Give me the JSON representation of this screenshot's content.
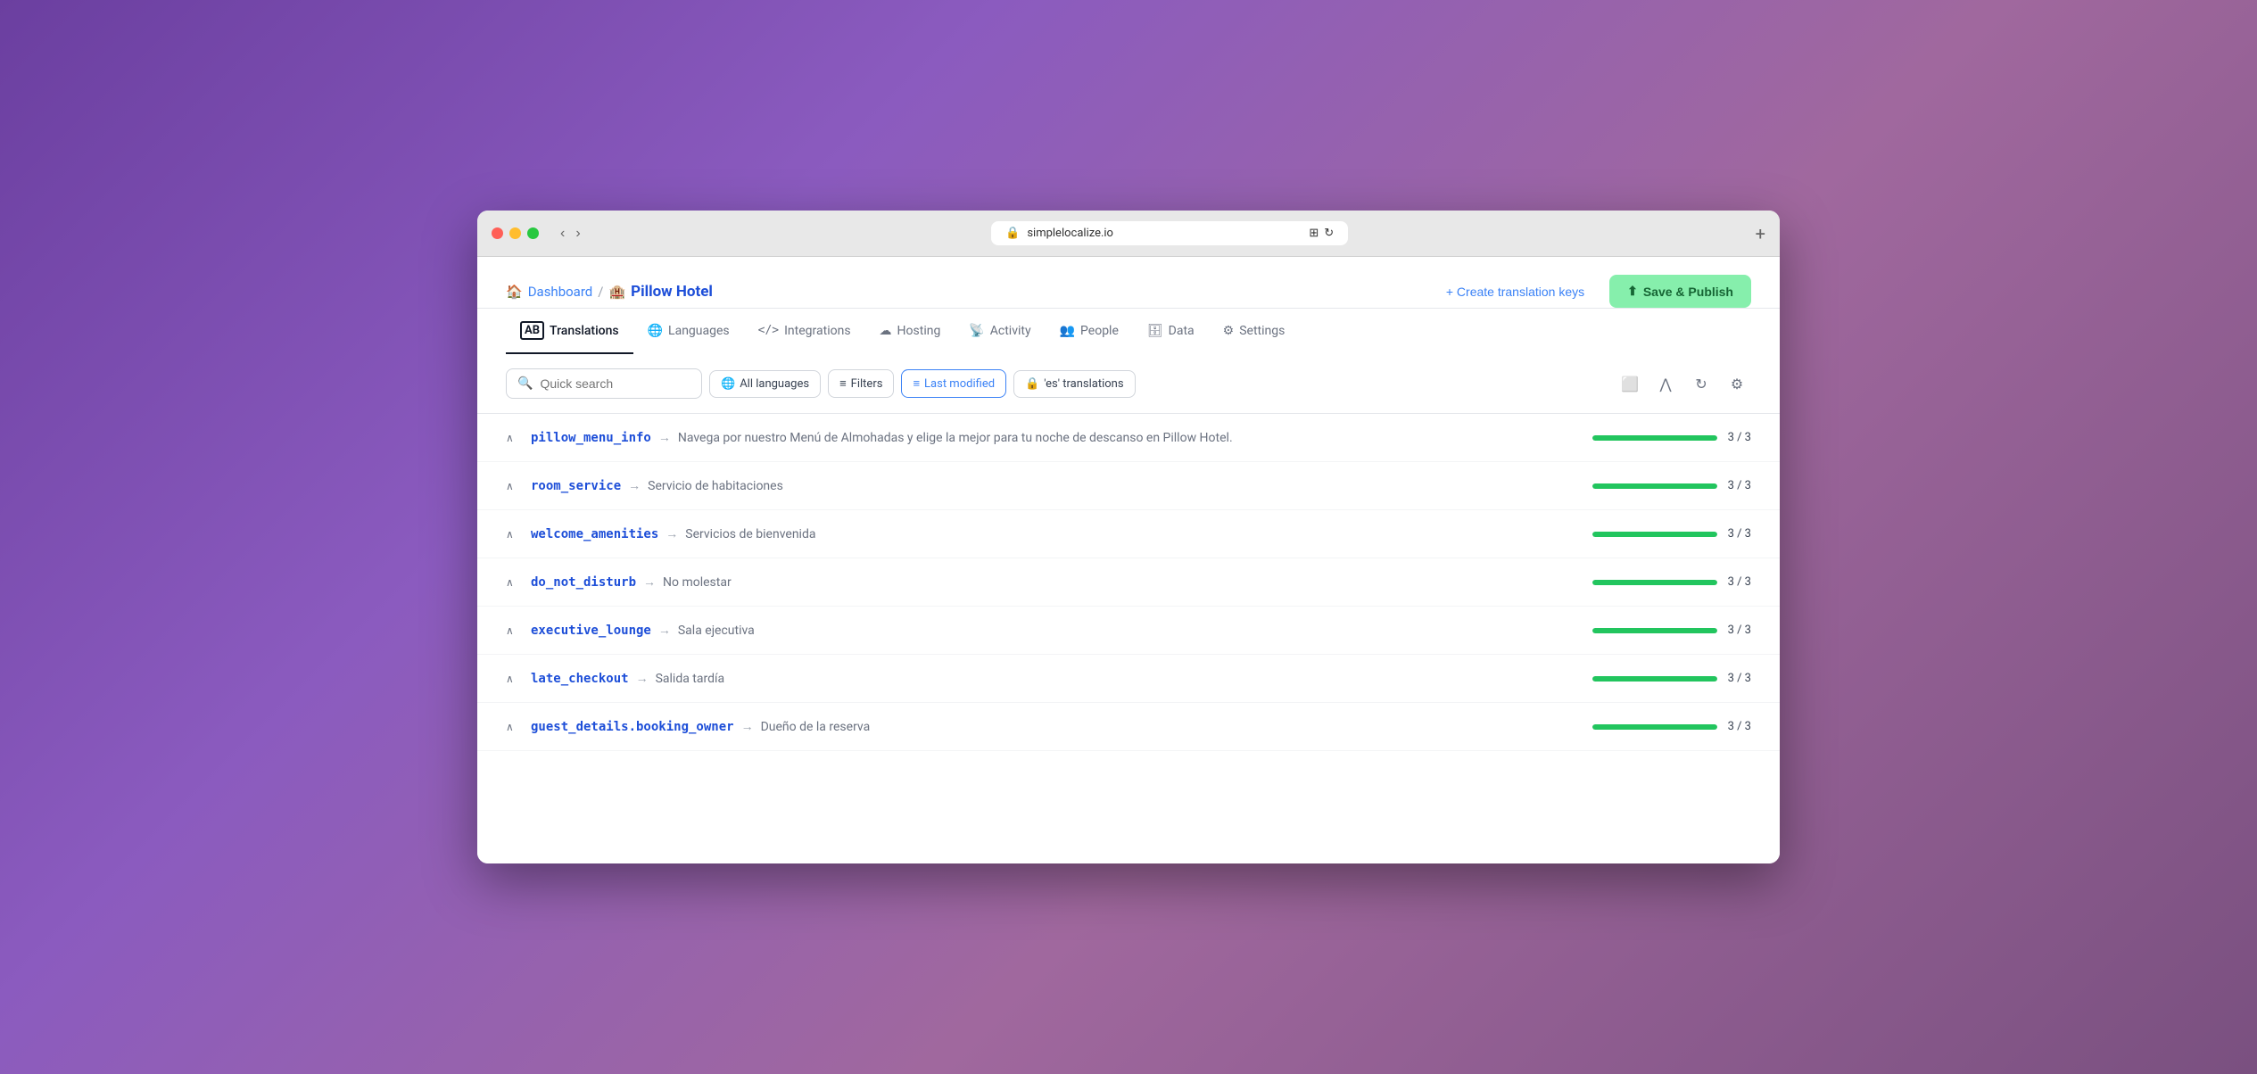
{
  "browser": {
    "url": "simplelocalize.io",
    "lock_icon": "🔒",
    "add_tab": "+",
    "back_arrow": "‹",
    "forward_arrow": "›"
  },
  "breadcrumb": {
    "home_label": "Dashboard",
    "separator": "/",
    "hotel_emoji": "🏨",
    "current": "Pillow Hotel"
  },
  "actions": {
    "create_keys_label": "+ Create translation keys",
    "save_publish_label": "Save & Publish"
  },
  "nav": {
    "tabs": [
      {
        "id": "translations",
        "label": "Translations",
        "icon": "ab",
        "active": true
      },
      {
        "id": "languages",
        "label": "Languages",
        "icon": "🌐",
        "active": false
      },
      {
        "id": "integrations",
        "label": "Integrations",
        "icon": "</>",
        "active": false
      },
      {
        "id": "hosting",
        "label": "Hosting",
        "icon": "☁",
        "active": false
      },
      {
        "id": "activity",
        "label": "Activity",
        "icon": "📡",
        "active": false
      },
      {
        "id": "people",
        "label": "People",
        "icon": "👥",
        "active": false
      },
      {
        "id": "data",
        "label": "Data",
        "icon": "🗄",
        "active": false
      },
      {
        "id": "settings",
        "label": "Settings",
        "icon": "⚙",
        "active": false
      }
    ]
  },
  "filters": {
    "search_placeholder": "Quick search",
    "all_languages": "All languages",
    "filters": "Filters",
    "last_modified": "Last modified",
    "es_translations": "'es' translations"
  },
  "translations": [
    {
      "key": "pillow_menu_info",
      "value": "Navega por nuestro Menú de Almohadas y elige la mejor para tu noche de descanso en Pillow Hotel.",
      "progress": 100,
      "label": "3 / 3"
    },
    {
      "key": "room_service",
      "value": "Servicio de habitaciones",
      "progress": 100,
      "label": "3 / 3"
    },
    {
      "key": "welcome_amenities",
      "value": "Servicios de bienvenida",
      "progress": 100,
      "label": "3 / 3"
    },
    {
      "key": "do_not_disturb",
      "value": "No molestar",
      "progress": 100,
      "label": "3 / 3"
    },
    {
      "key": "executive_lounge",
      "value": "Sala ejecutiva",
      "progress": 100,
      "label": "3 / 3"
    },
    {
      "key": "late_checkout",
      "value": "Salida tardía",
      "progress": 100,
      "label": "3 / 3"
    },
    {
      "key": "guest_details.booking_owner",
      "value": "Dueño de la reserva",
      "progress": 100,
      "label": "3 / 3"
    }
  ]
}
